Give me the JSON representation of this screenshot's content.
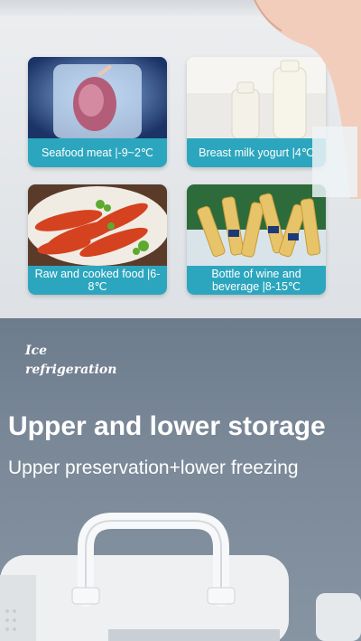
{
  "cards": [
    {
      "caption": "Seafood meat |-9~2℃"
    },
    {
      "caption": "Breast milk yogurt |4℃"
    },
    {
      "caption": "Raw and cooked food |6-8℃"
    },
    {
      "caption": "Bottle of wine and beverage |8-15℃"
    }
  ],
  "tag": {
    "line1": "Ice",
    "line2": "refrigeration"
  },
  "headline": "Upper and lower storage",
  "subline": "Upper preservation+lower freezing",
  "colors": {
    "caption_bg": "#2ca6be",
    "lower_bg": "#7a8898"
  }
}
